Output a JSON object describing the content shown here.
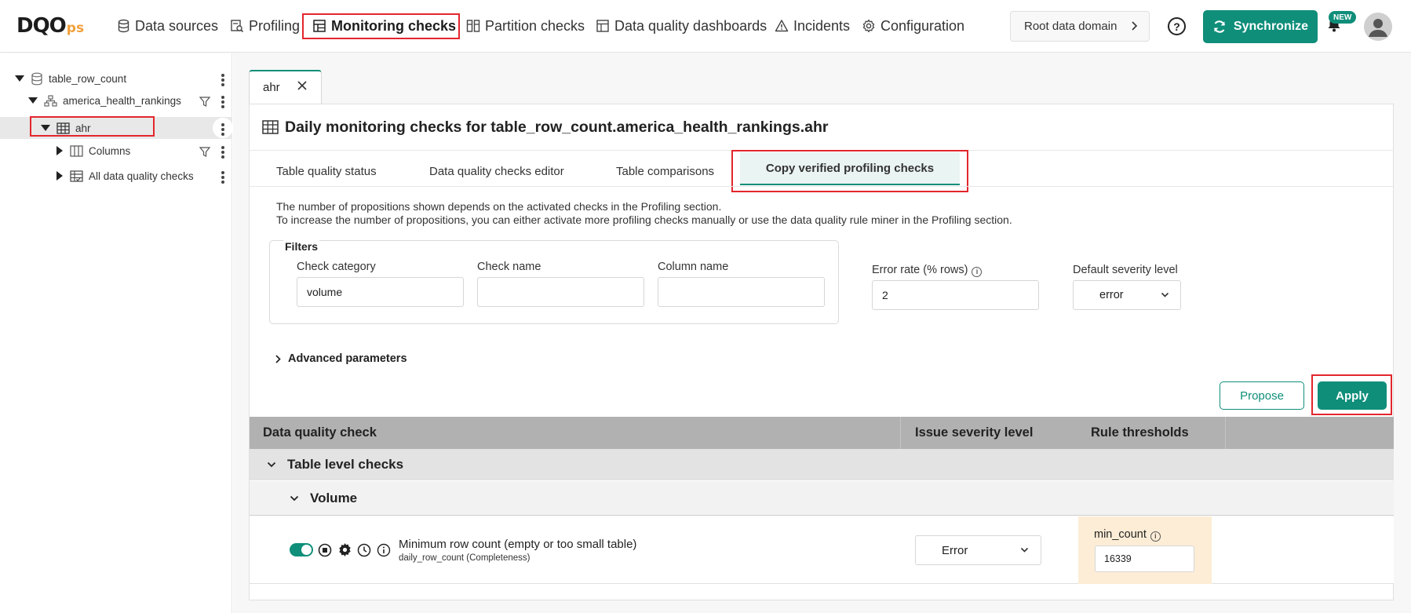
{
  "brand": {
    "logo": "DQO",
    "logo_suffix": "ps",
    "accent_color": "#0f8e7a",
    "highlight_color": "#e3262d"
  },
  "nav": {
    "items": [
      {
        "label": "Data sources",
        "icon": "database-icon"
      },
      {
        "label": "Profiling",
        "icon": "profiling-icon"
      },
      {
        "label": "Monitoring checks",
        "icon": "monitoring-icon",
        "active": true
      },
      {
        "label": "Partition checks",
        "icon": "partition-icon"
      },
      {
        "label": "Data quality dashboards",
        "icon": "dashboard-icon"
      },
      {
        "label": "Incidents",
        "icon": "warning-icon"
      },
      {
        "label": "Configuration",
        "icon": "gear-icon"
      }
    ],
    "domain": "Root data domain",
    "synchronize": "Synchronize",
    "new_badge": "NEW"
  },
  "tree": {
    "connection": "table_row_count",
    "schema": "america_health_rankings",
    "table": "ahr",
    "columns": "Columns",
    "all_checks": "All data quality checks"
  },
  "tab": {
    "label": "ahr"
  },
  "page": {
    "title": "Daily monitoring checks for table_row_count.america_health_rankings.ahr"
  },
  "subtabs": [
    "Table quality status",
    "Data quality checks editor",
    "Table comparisons",
    "Copy verified profiling checks"
  ],
  "info": {
    "line1": "The number of propositions shown depends on the activated checks in the Profiling section.",
    "line2": "To increase the number of propositions, you can either activate more profiling checks manually or use the data quality rule miner in the Profiling section."
  },
  "filters": {
    "legend": "Filters",
    "check_category_label": "Check category",
    "check_category_value": "volume",
    "check_name_label": "Check name",
    "check_name_value": "",
    "column_name_label": "Column name",
    "column_name_value": "",
    "error_rate_label": "Error rate (% rows)",
    "error_rate_value": "2",
    "severity_label": "Default severity level",
    "severity_value": "error"
  },
  "advanced": "Advanced parameters",
  "buttons": {
    "propose": "Propose",
    "apply": "Apply"
  },
  "table": {
    "headers": [
      "Data quality check",
      "Issue severity level",
      "Rule thresholds"
    ],
    "group": "Table level checks",
    "category": "Volume",
    "check": {
      "enabled": true,
      "name": "Minimum row count (empty or too small table)",
      "sub": "daily_row_count (Completeness)",
      "severity": "Error",
      "threshold_label": "min_count",
      "threshold_value": "16339"
    }
  }
}
